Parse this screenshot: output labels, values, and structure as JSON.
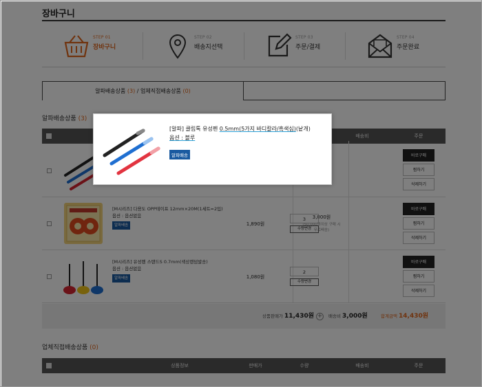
{
  "page": {
    "title": "장바구니"
  },
  "steps": [
    {
      "num": "STEP 01",
      "label": "장바구니",
      "icon": "basket-icon",
      "active": true
    },
    {
      "num": "STEP 02",
      "label": "배송지선택",
      "icon": "location-pin-icon",
      "active": false
    },
    {
      "num": "STEP 03",
      "label": "주문/결제",
      "icon": "edit-icon",
      "active": false
    },
    {
      "num": "STEP 04",
      "label": "주문완료",
      "icon": "envelope-icon",
      "active": false
    }
  ],
  "tabs": [
    {
      "label": "알파배송상품",
      "count": "(3)",
      "sep": " / ",
      "label2": "업체직접배송상품",
      "count2": "(0)"
    }
  ],
  "section1": {
    "title": "알파배송상품",
    "count": "(3)"
  },
  "table_headers": {
    "product": "상품정보",
    "price": "판매가",
    "qty": "수량",
    "shipping": "배송비",
    "order": "주문"
  },
  "rows": [
    {
      "name": "[알파] 클립톡 유성펜 0.5mm(5가지 바디칼라/흑색심)(낱개)",
      "option": "옵션 : 블루",
      "badge": "알파배송",
      "price": "",
      "qty": ""
    },
    {
      "name": "[M시리즈] 다용도 OPP테이프 12mm×20M(1세트=2입)",
      "option": "옵션 : 옵션없음",
      "badge": "알파배송",
      "price": "1,890원",
      "qty": "3"
    },
    {
      "name": "[M시리즈] 유성펜 스탠드S 0.7mm(색상랜덤발송)",
      "option": "옵션 : 옵션없음",
      "badge": "알파배송",
      "price": "1,080원",
      "qty": "2"
    }
  ],
  "row_actions": {
    "buy": "바로구매",
    "wish": "찜하기",
    "delete": "삭제하기",
    "qty_change": "수량변경"
  },
  "shipping": {
    "fee": "3,000원",
    "note1": "(50,000원이상 구매 시",
    "note2": "무료배송)"
  },
  "summary": {
    "subtotal_label": "상품판매가",
    "subtotal": "11,430원",
    "shipping_label": "배송비",
    "shipping": "3,000원",
    "total_label": "합계금액",
    "total": "14,430원"
  },
  "section2": {
    "title": "업체직접배송상품",
    "count": "(0)"
  },
  "popup": {
    "name_pre": "[알파] 클립톡 유성펜 ",
    "name_link": "0.5mm(5가지 바디칼라/흑색심)",
    "name_post": "(낱개)",
    "option": "옵션 : 블루",
    "badge": "알파배송"
  },
  "colors": {
    "accent": "#e0661c",
    "badge": "#1a5aa0",
    "header": "#555555"
  }
}
